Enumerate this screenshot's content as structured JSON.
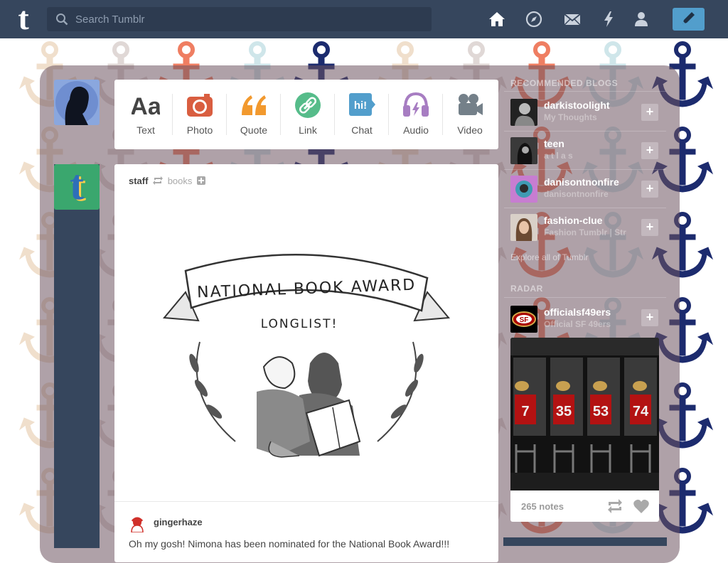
{
  "header": {
    "logo": "t",
    "search_placeholder": "Search Tumblr",
    "nav": [
      {
        "name": "home-icon"
      },
      {
        "name": "explore-compass-icon"
      },
      {
        "name": "inbox-mail-icon"
      },
      {
        "name": "activity-lightning-icon"
      },
      {
        "name": "account-person-icon"
      }
    ],
    "compose_icon": "pencil-icon"
  },
  "post_types": [
    {
      "label": "Text",
      "icon": "text-aa-icon"
    },
    {
      "label": "Photo",
      "icon": "camera-icon"
    },
    {
      "label": "Quote",
      "icon": "quote-icon"
    },
    {
      "label": "Link",
      "icon": "link-icon"
    },
    {
      "label": "Chat",
      "icon": "chat-hi-icon"
    },
    {
      "label": "Audio",
      "icon": "headphones-icon"
    },
    {
      "label": "Video",
      "icon": "video-camera-icon"
    }
  ],
  "post": {
    "author": "staff",
    "reblogged_from": "books",
    "illustration": {
      "line1": "NATIONAL BOOK AWARD",
      "line2": "LONGLIST!"
    },
    "commenter": "gingerhaze",
    "comment_text": "Oh my gosh! Nimona has been nominated for the National Book Award!!!"
  },
  "recommended": {
    "title": "RECOMMENDED BLOGS",
    "blogs": [
      {
        "name": "darkistoolight",
        "subtitle": "My Thoughts"
      },
      {
        "name": "teen",
        "subtitle": "a t l a s"
      },
      {
        "name": "danisontnonfire",
        "subtitle": "danisontnonfire"
      },
      {
        "name": "fashion-clue",
        "subtitle": "Fashion Tumblr | Str"
      }
    ],
    "follow_symbol": "+",
    "explore_link": "Explore all of Tumblr"
  },
  "radar": {
    "title": "RADAR",
    "blog": {
      "name": "officialsf49ers",
      "subtitle": "Official SF 49ers"
    },
    "jerseys": [
      "7",
      "35",
      "53",
      "74"
    ],
    "notes": "265 notes"
  },
  "colors": {
    "header_bg": "#36465d",
    "accent_blue": "#529ecc",
    "photo_red": "#d95e40",
    "quote_orange": "#f2992e",
    "link_green": "#56bc8a",
    "chat_blue": "#529ecc",
    "audio_purple": "#a77dc2",
    "video_gray": "#748089"
  }
}
